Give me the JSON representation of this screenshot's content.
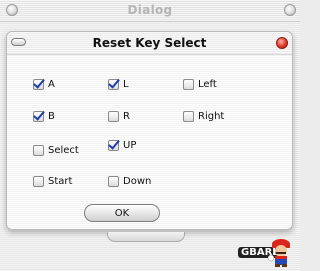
{
  "window": {
    "title": "Dialog"
  },
  "sheet": {
    "title": "Reset Key Select"
  },
  "checkboxes": [
    {
      "label": "A",
      "checked": true
    },
    {
      "label": "L",
      "checked": true
    },
    {
      "label": "Left",
      "checked": false
    },
    {
      "label": "B",
      "checked": true
    },
    {
      "label": "R",
      "checked": false
    },
    {
      "label": "Right",
      "checked": false
    },
    {
      "label": "Select",
      "checked": false
    },
    {
      "label": "UP",
      "checked": true
    },
    {
      "label": "Start",
      "checked": false
    },
    {
      "label": "Down",
      "checked": false
    }
  ],
  "ok_button": {
    "label": "OK"
  },
  "logo": {
    "text": "GBARL",
    "icon": "mario-mascot-icon"
  },
  "colors": {
    "check": "#1f3fae",
    "close": "#e2382a"
  }
}
